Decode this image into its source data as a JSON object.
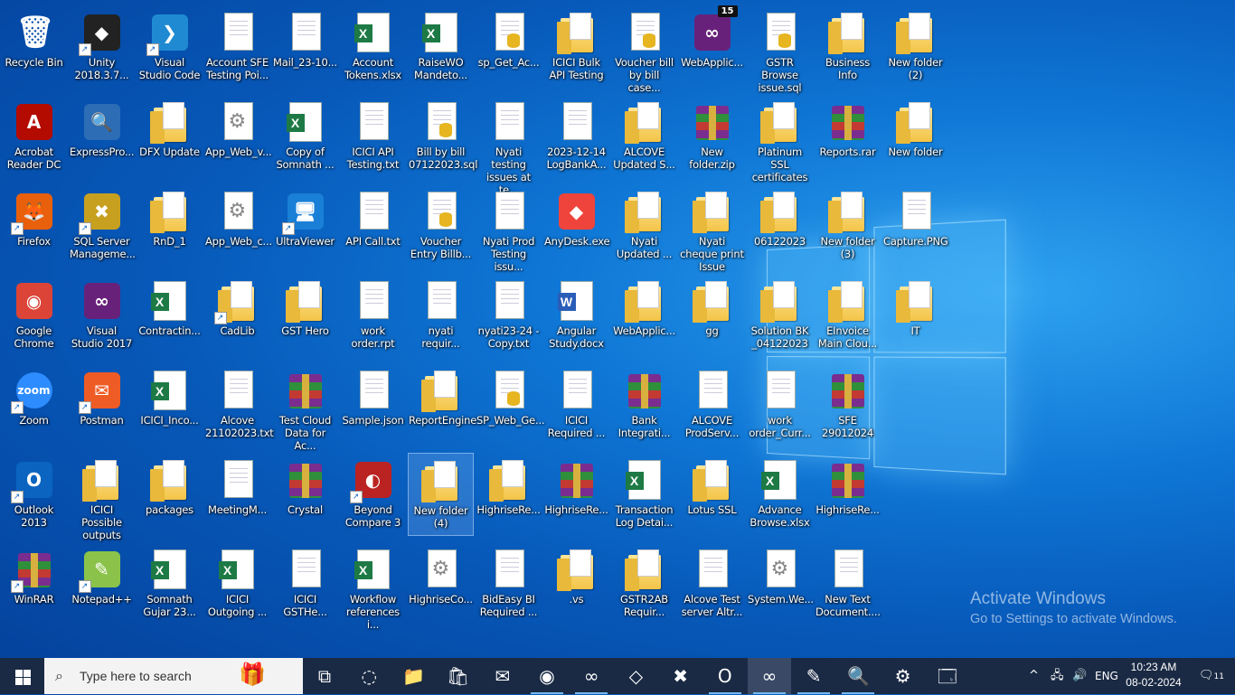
{
  "desktop": {
    "icons": [
      {
        "label": "Recycle Bin",
        "icon": "recycle-bin-icon",
        "type": "recycle"
      },
      {
        "label": "Unity 2018.3.7...",
        "icon": "unity-icon",
        "type": "app",
        "color": "#222",
        "glyph": "◆",
        "shortcut": true
      },
      {
        "label": "Visual Studio Code",
        "icon": "vscode-icon",
        "type": "app",
        "color": "#1f8ad2",
        "glyph": "❯",
        "shortcut": true
      },
      {
        "label": "Account SFE Testing Poi...",
        "icon": "text-file-icon",
        "type": "doc"
      },
      {
        "label": "Mail_23-10...",
        "icon": "image-file-icon",
        "type": "doc"
      },
      {
        "label": "Account Tokens.xlsx",
        "icon": "excel-file-icon",
        "type": "xl"
      },
      {
        "label": "RaiseWO Mandeto...",
        "icon": "excel-file-icon",
        "type": "xl"
      },
      {
        "label": "sp_Get_Ac...",
        "icon": "sql-file-icon",
        "type": "db"
      },
      {
        "label": "ICICI Bulk API Testing",
        "icon": "folder-icon",
        "type": "folder"
      },
      {
        "label": "Voucher bill by bill case...",
        "icon": "sql-file-icon",
        "type": "db"
      },
      {
        "label": "WebApplic...",
        "icon": "visual-studio-icon",
        "type": "app",
        "color": "#68217a",
        "glyph": "∞",
        "badge": "15"
      },
      {
        "label": "GSTR Browse issue.sql",
        "icon": "sql-file-icon",
        "type": "db"
      },
      {
        "label": "Business Info",
        "icon": "folder-icon",
        "type": "folder"
      },
      {
        "label": "New folder (2)",
        "icon": "folder-icon",
        "type": "folder"
      },
      {
        "label": "Acrobat Reader DC",
        "icon": "acrobat-icon",
        "type": "app",
        "color": "#b30b00",
        "glyph": "A"
      },
      {
        "label": "ExpressPro...",
        "icon": "sql-express-icon",
        "type": "app",
        "color": "#2d6db5",
        "glyph": "🔍"
      },
      {
        "label": "DFX Update",
        "icon": "folder-icon",
        "type": "folder"
      },
      {
        "label": "App_Web_v...",
        "icon": "config-file-icon",
        "type": "gear"
      },
      {
        "label": "Copy of Somnath ...",
        "icon": "excel-file-icon",
        "type": "xl"
      },
      {
        "label": "ICICI API Testing.txt",
        "icon": "text-file-icon",
        "type": "doc"
      },
      {
        "label": "Bill by bill 07122023.sql",
        "icon": "sql-file-icon",
        "type": "db"
      },
      {
        "label": "Nyati testing issues at te...",
        "icon": "text-file-icon",
        "type": "doc"
      },
      {
        "label": "2023-12-14 LogBankA...",
        "icon": "text-file-icon",
        "type": "doc"
      },
      {
        "label": "ALCOVE Updated S...",
        "icon": "folder-icon",
        "type": "folder"
      },
      {
        "label": "New folder.zip",
        "icon": "winrar-archive-icon",
        "type": "rar"
      },
      {
        "label": "Platinum SSL certificates",
        "icon": "folder-icon",
        "type": "folder"
      },
      {
        "label": "Reports.rar",
        "icon": "winrar-archive-icon",
        "type": "rar"
      },
      {
        "label": "New folder",
        "icon": "folder-icon",
        "type": "folder"
      },
      {
        "label": "Firefox",
        "icon": "firefox-icon",
        "type": "app",
        "color": "#e8600c",
        "glyph": "🦊",
        "shortcut": true
      },
      {
        "label": "SQL Server Manageme...",
        "icon": "sql-server-icon",
        "type": "app",
        "color": "#c8a020",
        "glyph": "✖",
        "shortcut": true
      },
      {
        "label": "RnD_1",
        "icon": "folder-icon",
        "type": "folder"
      },
      {
        "label": "App_Web_c...",
        "icon": "config-file-icon",
        "type": "gear"
      },
      {
        "label": "UltraViewer",
        "icon": "ultraviewer-icon",
        "type": "app",
        "color": "#1a7fd6",
        "glyph": "🖥",
        "shortcut": true
      },
      {
        "label": "API Call.txt",
        "icon": "text-file-icon",
        "type": "doc"
      },
      {
        "label": "Voucher Entry Billb...",
        "icon": "sql-file-icon",
        "type": "db"
      },
      {
        "label": "Nyati Prod Testing issu...",
        "icon": "text-file-icon",
        "type": "doc"
      },
      {
        "label": "AnyDesk.exe",
        "icon": "anydesk-icon",
        "type": "app",
        "color": "#ef443b",
        "glyph": "◆"
      },
      {
        "label": "Nyati Updated ...",
        "icon": "folder-icon",
        "type": "folder"
      },
      {
        "label": "Nyati cheque print Issue",
        "icon": "folder-icon",
        "type": "folder"
      },
      {
        "label": "06122023",
        "icon": "folder-icon",
        "type": "folder"
      },
      {
        "label": "New folder (3)",
        "icon": "folder-icon",
        "type": "folder"
      },
      {
        "label": "Capture.PNG",
        "icon": "image-file-icon",
        "type": "doc"
      },
      {
        "label": "Google Chrome",
        "icon": "chrome-icon",
        "type": "app",
        "color": "#db4437",
        "glyph": "◉"
      },
      {
        "label": "Visual Studio 2017",
        "icon": "visual-studio-icon",
        "type": "app",
        "color": "#68217a",
        "glyph": "∞"
      },
      {
        "label": "Contractin...",
        "icon": "excel-file-icon",
        "type": "xl"
      },
      {
        "label": "CadLib",
        "icon": "folder-icon",
        "type": "folder",
        "shortcut": true
      },
      {
        "label": "GST Hero",
        "icon": "folder-icon",
        "type": "folder"
      },
      {
        "label": "work order.rpt",
        "icon": "report-file-icon",
        "type": "doc"
      },
      {
        "label": "nyati requir...",
        "icon": "text-file-icon",
        "type": "doc"
      },
      {
        "label": "nyati23-24 - Copy.txt",
        "icon": "text-file-icon",
        "type": "doc"
      },
      {
        "label": "Angular Study.docx",
        "icon": "word-file-icon",
        "type": "wd"
      },
      {
        "label": "WebApplic...",
        "icon": "folder-icon",
        "type": "folder"
      },
      {
        "label": "gg",
        "icon": "folder-icon",
        "type": "folder"
      },
      {
        "label": "Solution BK _04122023",
        "icon": "folder-icon",
        "type": "folder"
      },
      {
        "label": "EInvoice Main Clou...",
        "icon": "folder-icon",
        "type": "folder"
      },
      {
        "label": "IT",
        "icon": "folder-icon",
        "type": "folder"
      },
      {
        "label": "Zoom",
        "icon": "zoom-icon",
        "type": "app",
        "color": "#2d8cff",
        "glyph": "zoom",
        "shortcut": true
      },
      {
        "label": "Postman",
        "icon": "postman-icon",
        "type": "app",
        "color": "#ef5b25",
        "glyph": "✉",
        "shortcut": true
      },
      {
        "label": "ICICI_Inco...",
        "icon": "excel-file-icon",
        "type": "xl"
      },
      {
        "label": "Alcove 21102023.txt",
        "icon": "text-file-icon",
        "type": "doc"
      },
      {
        "label": "Test Cloud Data for Ac...",
        "icon": "winrar-archive-icon",
        "type": "rar"
      },
      {
        "label": "Sample.json",
        "icon": "json-file-icon",
        "type": "doc"
      },
      {
        "label": "ReportEngine",
        "icon": "folder-icon",
        "type": "folder"
      },
      {
        "label": "SP_Web_Ge...",
        "icon": "sql-file-icon",
        "type": "db"
      },
      {
        "label": "ICICI Required ...",
        "icon": "text-file-icon",
        "type": "doc"
      },
      {
        "label": "Bank Integrati...",
        "icon": "winrar-archive-icon",
        "type": "rar"
      },
      {
        "label": "ALCOVE ProdServ...",
        "icon": "text-file-icon",
        "type": "doc"
      },
      {
        "label": "work order_Curr...",
        "icon": "report-file-icon",
        "type": "doc"
      },
      {
        "label": "SFE 29012024",
        "icon": "winrar-archive-icon",
        "type": "rar"
      },
      {
        "label": "",
        "icon": "",
        "type": "none"
      },
      {
        "label": "Outlook 2013",
        "icon": "outlook-icon",
        "type": "app",
        "color": "#0a64c0",
        "glyph": "O",
        "shortcut": true
      },
      {
        "label": "ICICI Possible outputs",
        "icon": "folder-icon",
        "type": "folder"
      },
      {
        "label": "packages",
        "icon": "folder-icon",
        "type": "folder"
      },
      {
        "label": "MeetingM...",
        "icon": "text-file-icon",
        "type": "doc"
      },
      {
        "label": "Crystal",
        "icon": "winrar-archive-icon",
        "type": "rar"
      },
      {
        "label": "Beyond Compare 3",
        "icon": "beyond-compare-icon",
        "type": "app",
        "color": "#b22",
        "glyph": "◐",
        "shortcut": true
      },
      {
        "label": "New folder (4)",
        "icon": "folder-icon",
        "type": "folder",
        "selected": true
      },
      {
        "label": "HighriseRe...",
        "icon": "folder-icon",
        "type": "folder"
      },
      {
        "label": "HighriseRe...",
        "icon": "winrar-archive-icon",
        "type": "rar"
      },
      {
        "label": "Transaction Log Detai...",
        "icon": "excel-file-icon",
        "type": "xl"
      },
      {
        "label": "Lotus SSL",
        "icon": "folder-icon",
        "type": "folder"
      },
      {
        "label": "Advance Browse.xlsx",
        "icon": "excel-file-icon",
        "type": "xl"
      },
      {
        "label": "HighriseRe...",
        "icon": "winrar-archive-icon",
        "type": "rar"
      },
      {
        "label": "",
        "icon": "",
        "type": "none"
      },
      {
        "label": "WinRAR",
        "icon": "winrar-icon",
        "type": "rar",
        "shortcut": true
      },
      {
        "label": "Notepad++",
        "icon": "notepad-plus-plus-icon",
        "type": "app",
        "color": "#8bc34a",
        "glyph": "✎",
        "shortcut": true
      },
      {
        "label": "Somnath Gujar 23...",
        "icon": "excel-file-icon",
        "type": "xl"
      },
      {
        "label": "ICICI Outgoing ...",
        "icon": "excel-file-icon",
        "type": "xl"
      },
      {
        "label": "ICICI GSTHe...",
        "icon": "text-file-icon",
        "type": "doc"
      },
      {
        "label": "Workflow references i...",
        "icon": "excel-file-icon",
        "type": "xl"
      },
      {
        "label": "HighriseCo...",
        "icon": "config-file-icon",
        "type": "gear"
      },
      {
        "label": "BidEasy BI Required ...",
        "icon": "text-file-icon",
        "type": "doc"
      },
      {
        "label": ".vs",
        "icon": "folder-icon",
        "type": "folder"
      },
      {
        "label": "GSTR2AB Requir...",
        "icon": "folder-icon",
        "type": "folder"
      },
      {
        "label": "Alcove Test server Altr...",
        "icon": "image-file-icon",
        "type": "doc"
      },
      {
        "label": "System.We...",
        "icon": "config-file-icon",
        "type": "gear"
      },
      {
        "label": "New Text Document....",
        "icon": "text-file-icon",
        "type": "doc"
      },
      {
        "label": "",
        "icon": "",
        "type": "none"
      }
    ]
  },
  "watermark": {
    "title": "Activate Windows",
    "subtitle": "Go to Settings to activate Windows."
  },
  "taskbar": {
    "search_placeholder": "Type here to search",
    "apps": [
      {
        "name": "task-view-icon",
        "glyph": "⧉"
      },
      {
        "name": "edge-icon",
        "glyph": "◌"
      },
      {
        "name": "file-explorer-icon",
        "glyph": "📁"
      },
      {
        "name": "microsoft-store-icon",
        "glyph": "🛍"
      },
      {
        "name": "mail-icon",
        "glyph": "✉"
      },
      {
        "name": "chrome-icon",
        "glyph": "◉",
        "on": true
      },
      {
        "name": "visual-studio-icon",
        "glyph": "∞",
        "on": true
      },
      {
        "name": "crystal-reports-icon",
        "glyph": "◇"
      },
      {
        "name": "sql-server-icon",
        "glyph": "✖"
      },
      {
        "name": "outlook-icon",
        "glyph": "O",
        "on": true
      },
      {
        "name": "visual-studio-2022-icon",
        "glyph": "∞",
        "on": true,
        "active": true
      },
      {
        "name": "notepad-plus-plus-icon",
        "glyph": "✎",
        "on": true
      },
      {
        "name": "sql-express-icon",
        "glyph": "🔍",
        "on": true
      },
      {
        "name": "network-tool-icon",
        "glyph": "⚙"
      },
      {
        "name": "remote-desktop-icon",
        "glyph": "🗔"
      }
    ],
    "language": "ENG",
    "time": "10:23 AM",
    "date": "08-02-2024",
    "notifications": "11"
  },
  "colors": {
    "taskbar_bg": "#1a2a44",
    "accent": "#76b9ed"
  }
}
